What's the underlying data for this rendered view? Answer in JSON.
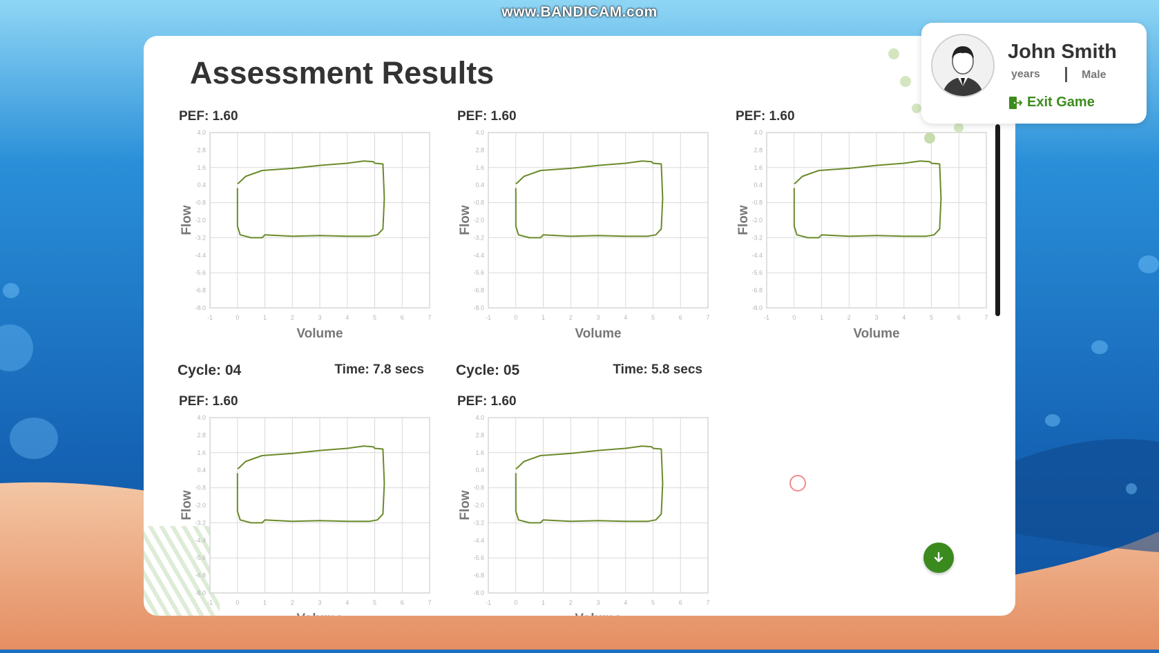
{
  "watermark": "www.BANDICAM.com",
  "page": {
    "title": "Assessment Results"
  },
  "user": {
    "name": "John Smith",
    "age": "years",
    "gender": "Male",
    "exit_label": "Exit Game"
  },
  "icons": {
    "avatar": "user-avatar-icon",
    "exit": "exit-door-icon",
    "scroll_down": "arrow-down-icon"
  },
  "colors": {
    "accent": "#3c8c1c",
    "curve": "#6a8a2a",
    "grid": "#d9d9d9",
    "text": "#333333"
  },
  "charts": [
    {
      "cycle": "",
      "time": "",
      "pef": "PEF: 1.60"
    },
    {
      "cycle": "",
      "time": "",
      "pef": "PEF: 1.60"
    },
    {
      "cycle": "",
      "time": "",
      "pef": "PEF: 1.60"
    },
    {
      "cycle": "Cycle: 04",
      "time": "Time: 7.8 secs",
      "pef": "PEF: 1.60"
    },
    {
      "cycle": "Cycle: 05",
      "time": "Time: 5.8 secs",
      "pef": "PEF: 1.60"
    }
  ],
  "chart_data": [
    {
      "type": "line",
      "xlabel": "Volume",
      "ylabel": "Flow",
      "x_ticks": [
        "-1",
        "0",
        "1",
        "2",
        "3",
        "4",
        "5",
        "6",
        "7"
      ],
      "y_ticks": [
        "4.0",
        "2.8",
        "1.6",
        "0.4",
        "-0.8",
        "-2.0",
        "-3.2",
        "-4.4",
        "-5.6",
        "-6.8",
        "-8.0"
      ],
      "xlim": [
        -1,
        7
      ],
      "ylim": [
        -8,
        4
      ]
    },
    {
      "type": "line",
      "xlabel": "Volume",
      "ylabel": "Flow",
      "x_ticks": [
        "-1",
        "0",
        "1",
        "2",
        "3",
        "4",
        "5",
        "6",
        "7"
      ],
      "y_ticks": [
        "4.0",
        "2.8",
        "1.6",
        "0.4",
        "-0.8",
        "-2.0",
        "-3.2",
        "-4.4",
        "-5.6",
        "-6.8",
        "-8.0"
      ],
      "xlim": [
        -1,
        7
      ],
      "ylim": [
        -8,
        4
      ]
    },
    {
      "type": "line",
      "xlabel": "Volume",
      "ylabel": "Flow",
      "x_ticks": [
        "-1",
        "0",
        "1",
        "2",
        "3",
        "4",
        "5",
        "6",
        "7"
      ],
      "y_ticks": [
        "4.0",
        "2.8",
        "1.6",
        "0.4",
        "-0.8",
        "-2.0",
        "-3.2",
        "-4.4",
        "-5.6",
        "-6.8",
        "-8.0"
      ],
      "xlim": [
        -1,
        7
      ],
      "ylim": [
        -8,
        4
      ]
    },
    {
      "type": "line",
      "xlabel": "Volume",
      "ylabel": "Flow",
      "x_ticks": [
        "-1",
        "0",
        "1",
        "2",
        "3",
        "4",
        "5",
        "6",
        "7"
      ],
      "y_ticks": [
        "4.0",
        "2.8",
        "1.6",
        "0.4",
        "-0.8",
        "-2.0",
        "-3.2",
        "-4.4",
        "-5.6",
        "-6.8",
        "-8.0"
      ],
      "xlim": [
        -1,
        7
      ],
      "ylim": [
        -8,
        4
      ]
    },
    {
      "type": "line",
      "xlabel": "Volume",
      "ylabel": "Flow",
      "x_ticks": [
        "-1",
        "0",
        "1",
        "2",
        "3",
        "4",
        "5",
        "6",
        "7"
      ],
      "y_ticks": [
        "4.0",
        "2.8",
        "1.6",
        "0.4",
        "-0.8",
        "-2.0",
        "-3.2",
        "-4.4",
        "-5.6",
        "-6.8",
        "-8.0"
      ],
      "xlim": [
        -1,
        7
      ],
      "ylim": [
        -8,
        4
      ]
    }
  ],
  "loop_curve": {
    "x": [
      0.0,
      0.05,
      0.3,
      0.9,
      2.0,
      3.0,
      4.0,
      4.6,
      4.95,
      5.0,
      5.3,
      5.35,
      5.3,
      5.1,
      4.8,
      4.0,
      3.0,
      2.0,
      1.0,
      0.9,
      0.5,
      0.1,
      0.0,
      0.0
    ],
    "y": [
      0.5,
      0.55,
      1.0,
      1.4,
      1.55,
      1.75,
      1.9,
      2.05,
      2.0,
      1.9,
      1.85,
      -0.5,
      -2.6,
      -3.0,
      -3.1,
      -3.1,
      -3.05,
      -3.1,
      -3.0,
      -3.2,
      -3.2,
      -3.0,
      -2.4,
      0.2
    ]
  }
}
